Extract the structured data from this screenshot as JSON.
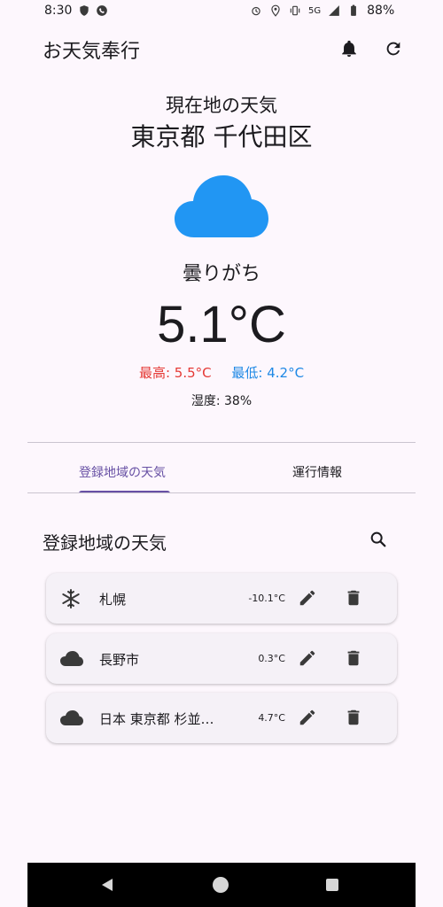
{
  "status_bar": {
    "time": "8:30",
    "network": "5G",
    "battery": "88%"
  },
  "app_bar": {
    "title": "お天気奉行",
    "icons": [
      "bell-icon",
      "refresh-icon"
    ]
  },
  "current_weather": {
    "label": "現在地の天気",
    "location": "東京都 千代田区",
    "icon": "cloud-icon",
    "condition": "曇りがち",
    "temperature": "5.1°C",
    "high": "最高: 5.5°C",
    "low": "最低: 4.2°C",
    "humidity": "湿度: 38%"
  },
  "tabs": [
    {
      "label": "登録地域の天気",
      "active": true
    },
    {
      "label": "運行情報",
      "active": false
    }
  ],
  "list": {
    "title": "登録地域の天気",
    "items": [
      {
        "icon": "snowflake-icon",
        "name": "札幌",
        "temp": "-10.1°C"
      },
      {
        "icon": "cloud-icon",
        "name": "長野市",
        "temp": "0.3°C"
      },
      {
        "icon": "cloud-icon",
        "name": "日本 東京都 杉並…",
        "temp": "4.7°C"
      }
    ]
  },
  "colors": {
    "accent": "#6750a4",
    "high": "#e53935",
    "low": "#1e88e5",
    "cloud": "#2196f3"
  }
}
